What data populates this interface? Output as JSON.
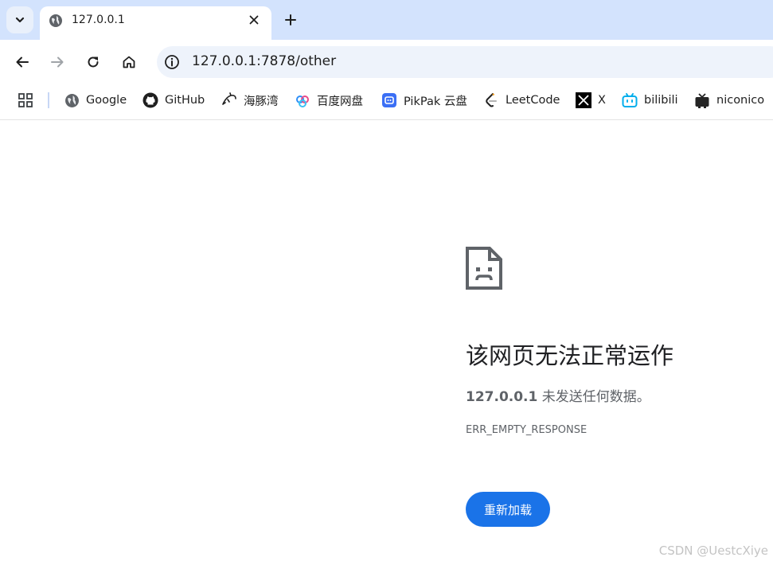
{
  "tabstrip": {
    "active_tab": {
      "title": "127.0.0.1",
      "favicon": "globe-icon"
    },
    "tab_search_icon": "chevron-down-icon",
    "new_tab_icon": "plus-icon"
  },
  "toolbar": {
    "back_icon": "arrow-left-icon",
    "forward_icon": "arrow-right-icon",
    "reload_icon": "reload-icon",
    "home_icon": "home-icon",
    "url": "127.0.0.1:7878/other",
    "site_info_icon": "info-icon"
  },
  "bookmarks": {
    "apps_icon": "apps-grid-icon",
    "items": [
      {
        "label": "Google",
        "icon": "globe-icon"
      },
      {
        "label": "GitHub",
        "icon": "github-icon"
      },
      {
        "label": "海豚湾",
        "icon": "dolphin-icon"
      },
      {
        "label": "百度网盘",
        "icon": "baidu-netdisk-icon"
      },
      {
        "label": "PikPak 云盘",
        "icon": "pikpak-icon"
      },
      {
        "label": "LeetCode",
        "icon": "leetcode-icon"
      },
      {
        "label": "X",
        "icon": "x-icon"
      },
      {
        "label": "bilibili",
        "icon": "bilibili-icon"
      },
      {
        "label": "niconico",
        "icon": "niconico-icon"
      }
    ]
  },
  "error": {
    "icon": "sad-page-icon",
    "title": "该网页无法正常运作",
    "host": "127.0.0.1",
    "message": "未发送任何数据。",
    "code": "ERR_EMPTY_RESPONSE",
    "reload_label": "重新加载"
  },
  "watermark": "CSDN @UestcXiye",
  "colors": {
    "accent": "#1a73e8",
    "tabstrip": "#d3e3fd",
    "omnibox": "#eef3fb"
  }
}
